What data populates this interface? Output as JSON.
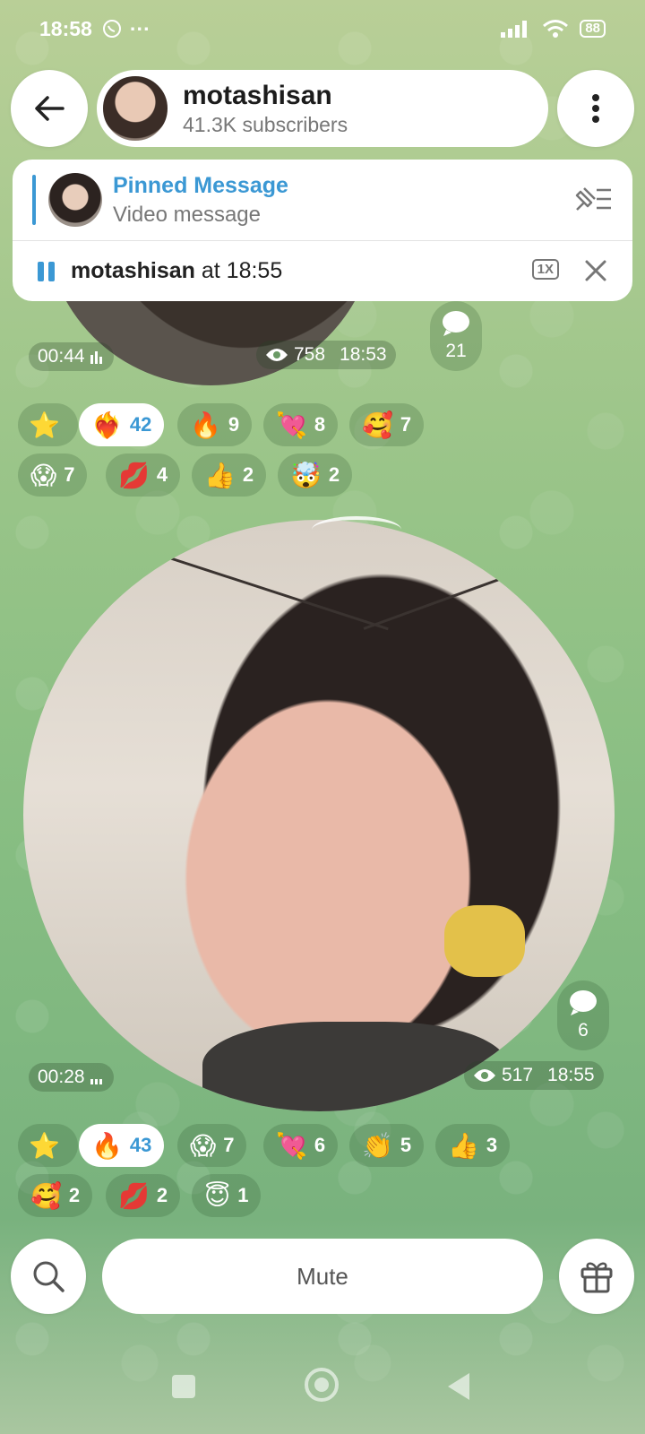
{
  "status_bar": {
    "time": "18:58",
    "dots": "···",
    "battery": "88"
  },
  "header": {
    "channel_name": "motashisan",
    "subscribers": "41.3K subscribers"
  },
  "pinned": {
    "title": "Pinned Message",
    "subtitle": "Video message"
  },
  "player": {
    "name": "motashisan",
    "at_text": " at 18:55",
    "speed": "1X"
  },
  "message1": {
    "duration": "00:44",
    "views": "758",
    "time": "18:53",
    "comments": "21",
    "reactions": [
      {
        "emoji": "⭐",
        "count": "",
        "active": false
      },
      {
        "emoji": "❤️‍🔥",
        "count": "42",
        "active": true
      },
      {
        "emoji": "🔥",
        "count": "9",
        "active": false
      },
      {
        "emoji": "💘",
        "count": "8",
        "active": false
      },
      {
        "emoji": "🥰",
        "count": "7",
        "active": false
      },
      {
        "emoji": "😱",
        "count": "7",
        "active": false
      },
      {
        "emoji": "💋",
        "count": "4",
        "active": false
      },
      {
        "emoji": "👍",
        "count": "2",
        "active": false
      },
      {
        "emoji": "🤯",
        "count": "2",
        "active": false
      }
    ]
  },
  "message2": {
    "duration": "00:28",
    "views": "517",
    "time": "18:55",
    "comments": "6",
    "reactions": [
      {
        "emoji": "⭐",
        "count": "",
        "active": false
      },
      {
        "emoji": "🔥",
        "count": "43",
        "active": true
      },
      {
        "emoji": "😱",
        "count": "7",
        "active": false
      },
      {
        "emoji": "💘",
        "count": "6",
        "active": false
      },
      {
        "emoji": "👏",
        "count": "5",
        "active": false
      },
      {
        "emoji": "👍",
        "count": "3",
        "active": false
      },
      {
        "emoji": "🥰",
        "count": "2",
        "active": false
      },
      {
        "emoji": "💋",
        "count": "2",
        "active": false
      },
      {
        "emoji": "😇",
        "count": "1",
        "active": false
      }
    ]
  },
  "bottom": {
    "mute_label": "Mute"
  },
  "colors": {
    "accent": "#3b98d4",
    "bubble": "#ffffff"
  }
}
